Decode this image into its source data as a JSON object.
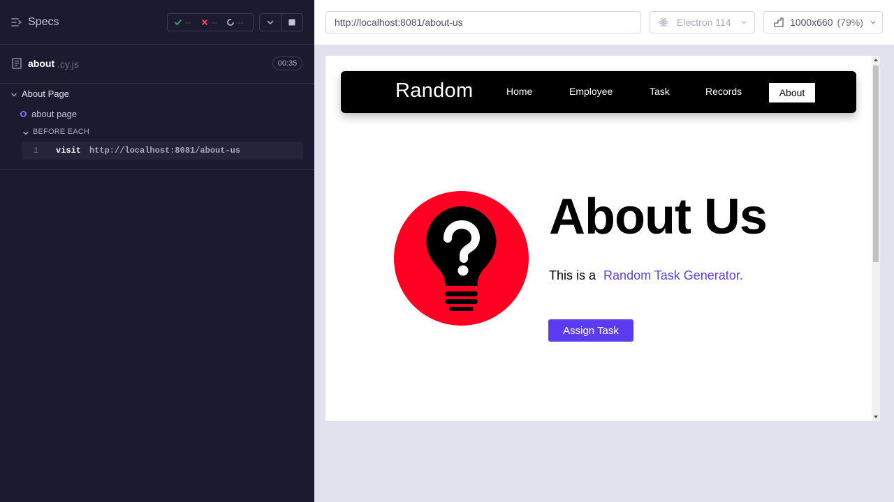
{
  "reporter": {
    "specs_label": "Specs",
    "stats": {
      "passed": "--",
      "failed": "--",
      "pending": "--"
    },
    "file": {
      "name": "about",
      "ext": ".cy.js",
      "duration": "00:35"
    },
    "suite": {
      "title": "About Page"
    },
    "test": {
      "title": "about page"
    },
    "hook": {
      "title": "BEFORE EACH"
    },
    "command": {
      "number": "1",
      "name": "visit",
      "message": "http://localhost:8081/about-us"
    }
  },
  "browser": {
    "url": "http://localhost:8081/about-us",
    "name": "Electron 114",
    "viewport": "1000x660",
    "zoom": "(79%)"
  },
  "app": {
    "brand": "Random",
    "nav": [
      "Home",
      "Employee",
      "Task",
      "Records"
    ],
    "nav_active": "About",
    "heading": "About Us",
    "intro_prefix": "This is a",
    "intro_highlight": "Random Task Generator.",
    "assign_button": "Assign Task",
    "accent_color": "#5b3cf0",
    "logo_color": "#ff0022"
  }
}
